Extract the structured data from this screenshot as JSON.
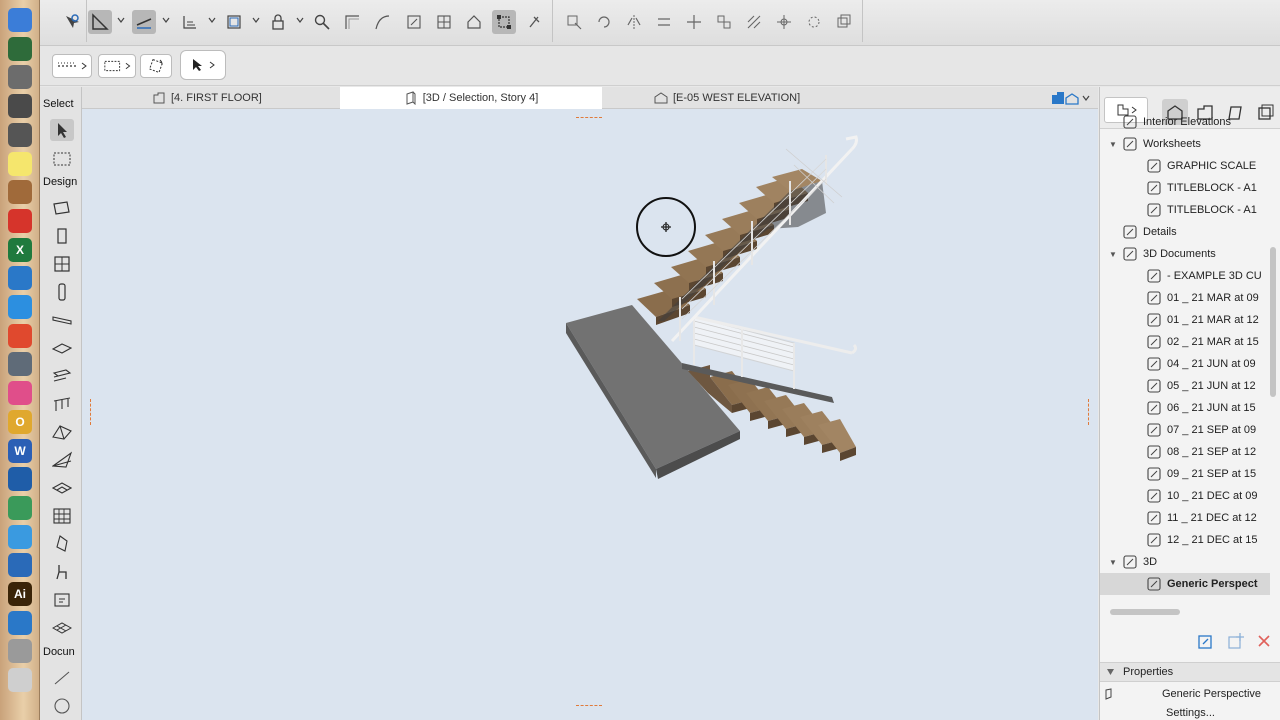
{
  "dock": {
    "apps": [
      {
        "icon": "finder-icon",
        "color": "#3b7dd8",
        "glyph": ""
      },
      {
        "icon": "dashboard-icon",
        "color": "#2e6b3a",
        "glyph": ""
      },
      {
        "icon": "photos-icon",
        "color": "#6c6c6c",
        "glyph": ""
      },
      {
        "icon": "launchpad-icon",
        "color": "#4a4a4a",
        "glyph": ""
      },
      {
        "icon": "system-prefs-icon",
        "color": "#555555",
        "glyph": ""
      },
      {
        "icon": "notes-icon",
        "color": "#f5e66d",
        "glyph": ""
      },
      {
        "icon": "book-icon",
        "color": "#a06a3a",
        "glyph": ""
      },
      {
        "icon": "acrobat-icon",
        "color": "#d6342b",
        "glyph": ""
      },
      {
        "icon": "excel-icon",
        "color": "#1f7a3e",
        "glyph": "X"
      },
      {
        "icon": "archicad-icon",
        "color": "#2a78c8",
        "glyph": ""
      },
      {
        "icon": "safari-icon",
        "color": "#2c8fe0",
        "glyph": ""
      },
      {
        "icon": "chrome-icon",
        "color": "#e0492e",
        "glyph": ""
      },
      {
        "icon": "scanner-icon",
        "color": "#5f6b78",
        "glyph": ""
      },
      {
        "icon": "itunes-icon",
        "color": "#e04e8a",
        "glyph": ""
      },
      {
        "icon": "outlook-icon",
        "color": "#e0a82e",
        "glyph": "O"
      },
      {
        "icon": "word-icon",
        "color": "#2b5fb5",
        "glyph": "W"
      },
      {
        "icon": "quicktime-icon",
        "color": "#1f5da8",
        "glyph": ""
      },
      {
        "icon": "sketchup-icon",
        "color": "#3a9a5a",
        "glyph": ""
      },
      {
        "icon": "messages-icon",
        "color": "#3a9ae0",
        "glyph": ""
      },
      {
        "icon": "archicad-alt-icon",
        "color": "#2a6ab8",
        "glyph": ""
      },
      {
        "icon": "illustrator-icon",
        "color": "#3a2408",
        "glyph": "Ai"
      },
      {
        "icon": "blueprint-icon",
        "color": "#2a78c8",
        "glyph": ""
      },
      {
        "icon": "spreadsheet-icon",
        "color": "#9a9a9a",
        "glyph": ""
      },
      {
        "icon": "document-icon",
        "color": "#cfcfcf",
        "glyph": ""
      }
    ]
  },
  "tabs": [
    {
      "label": "[4. FIRST FLOOR]",
      "icon": "floorplan-icon"
    },
    {
      "label": "[3D / Selection, Story 4]",
      "icon": "3d-window-icon"
    },
    {
      "label": "[E-05 WEST ELEVATION]",
      "icon": "elevation-icon"
    }
  ],
  "toolbox": {
    "select_heading": "Select",
    "design_heading": "Design",
    "document_heading": "Docun"
  },
  "navigator": {
    "tree": [
      {
        "label": "Interior Elevations",
        "indent": 1,
        "tri": false,
        "icon": "interior-elevations-icon"
      },
      {
        "label": "Worksheets",
        "indent": 1,
        "tri": true,
        "icon": "worksheets-icon"
      },
      {
        "label": "GRAPHIC SCALE",
        "indent": 2,
        "tri": false,
        "icon": "worksheet-icon"
      },
      {
        "label": "TITLEBLOCK - A1",
        "indent": 2,
        "tri": false,
        "icon": "worksheet-icon"
      },
      {
        "label": "TITLEBLOCK - A1",
        "indent": 2,
        "tri": false,
        "icon": "worksheet-icon"
      },
      {
        "label": "Details",
        "indent": 1,
        "tri": false,
        "icon": "details-icon"
      },
      {
        "label": "3D Documents",
        "indent": 1,
        "tri": true,
        "icon": "3d-documents-icon"
      },
      {
        "label": "- EXAMPLE 3D CU",
        "indent": 2,
        "tri": false,
        "icon": "3d-document-icon"
      },
      {
        "label": "01 _ 21 MAR at 09",
        "indent": 2,
        "tri": false,
        "icon": "3d-document-icon"
      },
      {
        "label": "01 _ 21 MAR at 12",
        "indent": 2,
        "tri": false,
        "icon": "3d-document-icon"
      },
      {
        "label": "02 _ 21 MAR at 15",
        "indent": 2,
        "tri": false,
        "icon": "3d-document-icon"
      },
      {
        "label": "04 _ 21 JUN at 09",
        "indent": 2,
        "tri": false,
        "icon": "3d-document-icon"
      },
      {
        "label": "05 _ 21 JUN at 12",
        "indent": 2,
        "tri": false,
        "icon": "3d-document-icon"
      },
      {
        "label": "06 _ 21 JUN at 15",
        "indent": 2,
        "tri": false,
        "icon": "3d-document-icon"
      },
      {
        "label": "07 _ 21 SEP at 09",
        "indent": 2,
        "tri": false,
        "icon": "3d-document-icon"
      },
      {
        "label": "08 _ 21 SEP at 12",
        "indent": 2,
        "tri": false,
        "icon": "3d-document-icon"
      },
      {
        "label": "09 _ 21 SEP at 15",
        "indent": 2,
        "tri": false,
        "icon": "3d-document-icon"
      },
      {
        "label": "10 _ 21 DEC at 09",
        "indent": 2,
        "tri": false,
        "icon": "3d-document-icon"
      },
      {
        "label": "11 _ 21 DEC at 12",
        "indent": 2,
        "tri": false,
        "icon": "3d-document-icon"
      },
      {
        "label": "12 _ 21 DEC at 15",
        "indent": 2,
        "tri": false,
        "icon": "3d-document-icon"
      },
      {
        "label": "3D",
        "indent": 1,
        "tri": true,
        "icon": "3d-icon"
      },
      {
        "label": "Generic Perspect",
        "indent": 2,
        "tri": false,
        "icon": "3d-view-icon",
        "selected": true
      }
    ],
    "properties_label": "Properties",
    "properties_value": "Generic Perspective",
    "settings_label": "Settings..."
  },
  "colors": {
    "viewport_bg": "#dbe4ef",
    "tread": "#7d6548",
    "tread_light": "#a3855f",
    "slab": "#6f6f6f",
    "rail": "#ededed"
  }
}
